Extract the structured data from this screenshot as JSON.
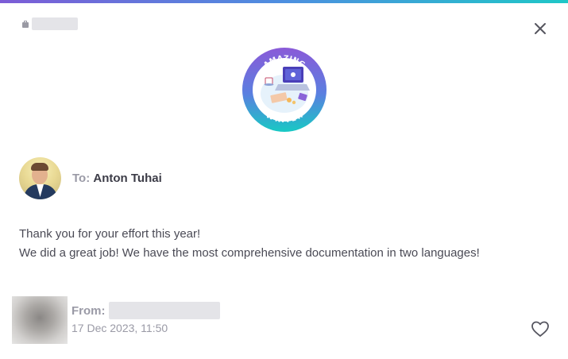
{
  "card": {
    "to_label": "To:",
    "recipient_name": "Anton Tuhai",
    "message_lines": [
      "Thank you for your effort this year!",
      "We did a great job! We have the most comprehensive documentation in two languages!"
    ],
    "from_label": "From:",
    "date": "17 Dec 2023, 11:50"
  },
  "badge": {
    "top_text": "AMAZING",
    "bottom_text": "WRITER"
  },
  "icons": {
    "close": "close-icon",
    "heart": "heart-icon",
    "briefcase": "briefcase-icon"
  },
  "colors": {
    "gradient_start": "#7c5cd6",
    "gradient_end": "#1fc7c7",
    "muted_text": "#9a9aa6"
  }
}
